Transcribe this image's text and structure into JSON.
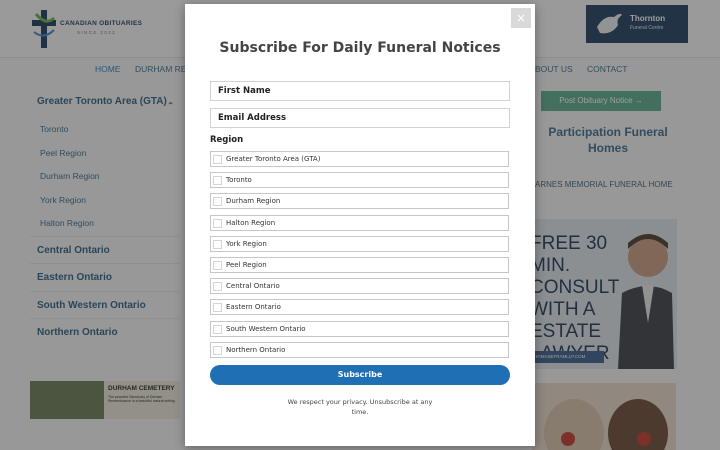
{
  "background": {
    "logo": {
      "title": "CANADIAN OBITUARIES",
      "subtitle": "SINCE 2022"
    },
    "sponsor": {
      "name": "Thornton",
      "sub": "Funeral Centre"
    },
    "nav": {
      "home": "HOME",
      "durham": "DURHAM RE",
      "about": "BOUT US",
      "contact": "CONTACT"
    },
    "sidebar": {
      "group_title": "Greater Toronto Area (GTA)",
      "items": [
        "Toronto",
        "Peel Region",
        "Durham Region",
        "York Region",
        "Halton Region"
      ],
      "regions": [
        "Central Ontario",
        "Eastern Ontario",
        "South Western Ontario",
        "Northern Ontario"
      ]
    },
    "cemetery_ad": {
      "title": "DURHAM CEMETERY",
      "sub": "The peaceful Sanctuary of Durham Remembrance in a beautiful natural setting"
    },
    "post_button": "Post Obituary Notice →",
    "participation_title": "Participation Funeral Homes",
    "barnes": "ARNES MEMORIAL FUNERAL HOME",
    "lawyer_ad": {
      "text_lines": [
        "FREE 30",
        "MIN.",
        "CONSULT",
        "WITH A",
        "ESTATE",
        "LAWYER"
      ],
      "url": "HOMASEFRAMLLP.COM"
    }
  },
  "modal": {
    "title": "Subscribe For Daily Funeral Notices",
    "first_name_placeholder": "First Name",
    "email_placeholder": "Email Address",
    "region_label": "Region",
    "regions": [
      "Greater Toronto Area (GTA)",
      "Toronto",
      "Durham Region",
      "Halton Region",
      "York Region",
      "Peel Region",
      "Central Ontario",
      "Eastern Ontario",
      "South Western Ontario",
      "Northern Ontario"
    ],
    "subscribe_label": "Subscribe",
    "privacy_text": "We respect your privacy. Unsubscribe at any time.",
    "close_label": "×"
  },
  "colors": {
    "accent": "#1f6fb4",
    "overlay": "rgba(40,40,40,0.45)",
    "nav_link": "#3e6e8e",
    "post_button": "#5aa98a"
  }
}
